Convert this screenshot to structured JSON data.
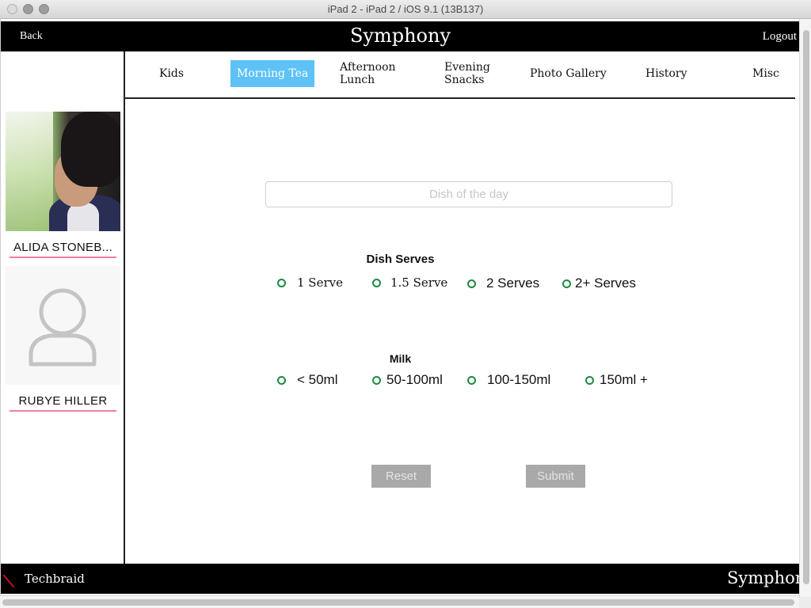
{
  "window": {
    "title": "iPad 2 - iPad 2 / iOS 9.1 (13B137)"
  },
  "header": {
    "back_label": "Back",
    "app_title": "Symphony",
    "logout_label": "Logout"
  },
  "tabs": [
    {
      "label": "Kids",
      "active": false
    },
    {
      "label": "Morning Tea",
      "active": true
    },
    {
      "label": "Afternoon\nLunch",
      "line1": "Afternoon",
      "line2": "Lunch",
      "active": false
    },
    {
      "label": "Evening\nSnacks",
      "line1": "Evening",
      "line2": "Snacks",
      "active": false
    },
    {
      "label": "Photo Gallery",
      "active": false
    },
    {
      "label": "History",
      "active": false
    },
    {
      "label": "Misc",
      "active": false
    }
  ],
  "sidebar": {
    "kids": [
      {
        "name": "ALIDA STONEB...",
        "has_photo": true
      },
      {
        "name": "RUBYE HILLER",
        "has_photo": false
      }
    ]
  },
  "form": {
    "dish_input": {
      "value": "",
      "placeholder": "Dish of the day"
    },
    "dish_serves": {
      "title": "Dish Serves",
      "options": [
        "1 Serve",
        "1.5 Serve",
        "2 Serves",
        "2+ Serves"
      ],
      "selected": null
    },
    "milk": {
      "title": "Milk",
      "options": [
        "< 50ml",
        "50-100ml",
        "100-150ml",
        "150ml +"
      ],
      "selected": null
    },
    "reset_label": "Reset",
    "submit_label": "Submit"
  },
  "footer": {
    "brand": "Techbraid",
    "app_name": "Symphony"
  },
  "colors": {
    "active_tab": "#5ec2f7",
    "radio_accent": "#1f8a44",
    "name_underline": "#ee7fa2",
    "button_disabled": "#a9a9a9"
  }
}
